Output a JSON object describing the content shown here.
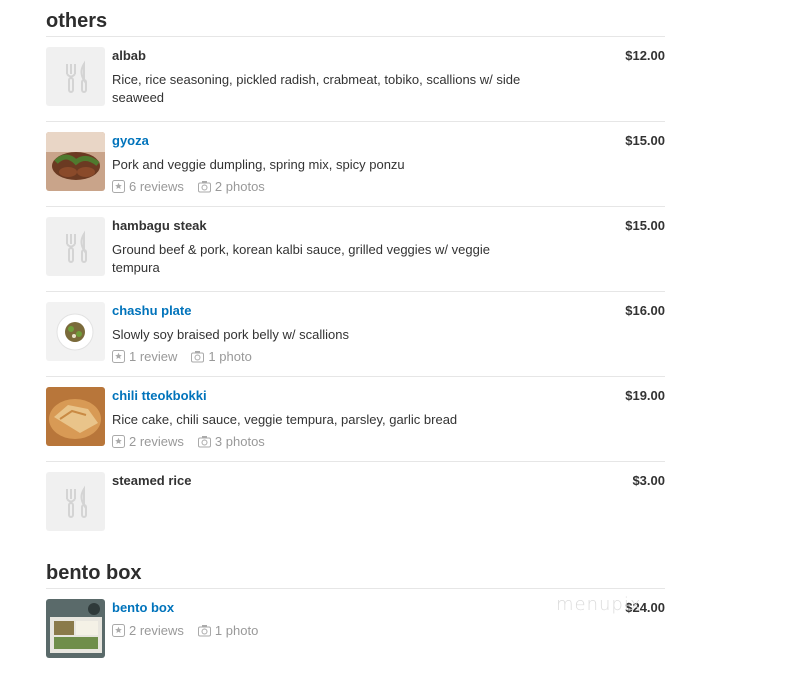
{
  "sections": [
    {
      "title": "others",
      "items": [
        {
          "name": "albab",
          "price": "$12.00",
          "desc": "Rice, rice seasoning, pickled radish, crabmeat, tobiko, scallions w/ side seaweed"
        },
        {
          "name": "gyoza",
          "price": "$15.00",
          "desc": "Pork and veggie dumpling, spring mix, spicy ponzu",
          "reviews": "6 reviews",
          "photos": "2 photos"
        },
        {
          "name": "hambagu steak",
          "price": "$15.00",
          "desc": "Ground beef & pork, korean kalbi sauce, grilled veggies w/ veggie tempura"
        },
        {
          "name": "chashu plate",
          "price": "$16.00",
          "desc": "Slowly soy braised pork belly w/ scallions",
          "reviews": "1 review",
          "photos": "1 photo"
        },
        {
          "name": "chili tteokbokki",
          "price": "$19.00",
          "desc": "Rice cake, chili sauce, veggie tempura, parsley, garlic bread",
          "reviews": "2 reviews",
          "photos": "3 photos"
        },
        {
          "name": "steamed rice",
          "price": "$3.00"
        }
      ]
    },
    {
      "title": "bento box",
      "items": [
        {
          "name": "bento box",
          "price": "$24.00",
          "reviews": "2 reviews",
          "photos": "1 photo"
        }
      ]
    }
  ],
  "watermark": "menupix",
  "icons": {
    "placeholder": "fork-knife-icon",
    "review": "review-star-icon",
    "photo": "camera-icon"
  },
  "colors": {
    "link": "#0073bb",
    "meta": "#999999",
    "divider": "#e6e6e6",
    "placeholder_bg": "#f0f0f0"
  }
}
